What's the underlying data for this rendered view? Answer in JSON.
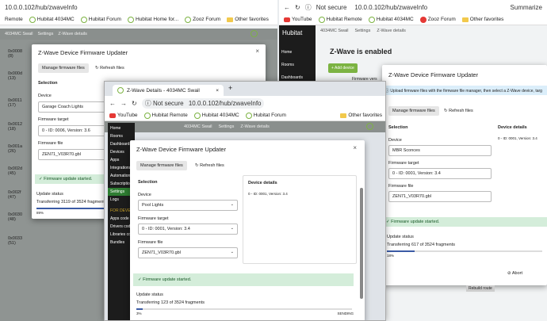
{
  "colors": {
    "accent": "#3b5ba5",
    "success_bg": "#d4edda",
    "hubitat_green": "#7cb342",
    "sidebar": "#1c1c1c"
  },
  "win_left": {
    "url": "10.0.0.102/hub/zwaveInfo",
    "bookmarks": [
      "Remote",
      "Hubitat 4034MC",
      "Hubitat Forum",
      "Hubitat Home for...",
      "Zooz Forum",
      "Other favorites"
    ],
    "breadcrumb": [
      "4034MC Swail",
      "Settings",
      "Z-Wave details"
    ],
    "rows": [
      "0x0008\n(8)",
      "0x000d\n(13)",
      "0x0011\n(17)",
      "0x0012\n(18)",
      "0x001a\n(26)",
      "0x002d\n(45)",
      "0x002f\n(47)",
      "0x0030\n(48)",
      "0x0033\n(51)"
    ],
    "modal": {
      "title": "Z-Wave Device Firmware Updater",
      "manage": "Manage firmware files",
      "refresh": "Refresh files",
      "selection": "Selection",
      "device_label": "Device",
      "device": "Garage Coach Lights",
      "target_label": "Firmware target",
      "target": "0 - ID: 0006, Version: 3.6",
      "file_label": "Firmware file",
      "file": "ZEN71_V03R70.gbl",
      "alert": "Firmware update started.",
      "status_label": "Update status",
      "status": "Transferring 3119 of 3524 fragments",
      "progress": 89,
      "pct": "89%"
    }
  },
  "win_mid": {
    "tab": "Z-Wave Details - 4034MC Swail",
    "url": "10.0.0.102/hub/zwaveInfo",
    "not_secure": "Not secure",
    "bookmarks": [
      "YouTube",
      "Hubitat Remote",
      "Hubitat 4034MC",
      "Hubitat Forum",
      "Other favorites"
    ],
    "breadcrumb": [
      "4034MC Swail",
      "Settings",
      "Z-Wave details"
    ],
    "sidebar": [
      "Home",
      "Rooms",
      "Dashboards",
      "Devices",
      "Apps",
      "Integrations",
      "Automations",
      "Subscriptions",
      "Settings",
      "Logs",
      "FOR DEVELOPERS",
      "Apps code",
      "Drivers code",
      "Libraries code",
      "Bundles"
    ],
    "modal": {
      "title": "Z-Wave Device Firmware Updater",
      "manage": "Manage firmware files",
      "refresh": "Refresh files",
      "selection": "Selection",
      "details": "Device details",
      "details_text": "0 - ID: 0001, Version: 3.4",
      "device_label": "Device",
      "device": "Pool Lights",
      "target_label": "Firmware target",
      "target": "0 - ID: 0001, Version: 3.4",
      "file_label": "Firmware file",
      "file": "ZEN71_V03R70.gbl",
      "alert": "Firmware update started.",
      "status_label": "Update status",
      "status": "Transferring 123 of 3524 fragments",
      "progress": 3,
      "pct": "3%",
      "state": "SENDING"
    }
  },
  "win_right": {
    "url": "10.0.0.102/hub/zwaveInfo",
    "not_secure": "Not secure",
    "summarize": "Summarize",
    "bookmarks": [
      "YouTube",
      "Hubitat Remote",
      "Hubitat 4034MC",
      "Zooz Forum",
      "Other favorites"
    ],
    "app": "Hubitat",
    "breadcrumb": [
      "4034MC Swail",
      "Settings",
      "Z-Wave details"
    ],
    "sidebar": [
      "Home",
      "Rooms",
      "Dashboards"
    ],
    "zwave": "Z-Wave is enabled",
    "add_device": "+ Add device",
    "fw_ver": "Firmware vers",
    "modal": {
      "title": "Z-Wave Device Firmware Updater",
      "info": "Upload firmware files with the firmware file manager, then select a Z-Wave device, targ",
      "manage": "Manage firmware files",
      "refresh": "Refresh files",
      "selection": "Selection",
      "details": "Device details",
      "details_text": "0 - ID: 0001, Version: 3.4",
      "device_label": "Device",
      "device": "MBR Sconces",
      "target_label": "Firmware target",
      "target": "0 - ID: 0001, Version: 3.4",
      "file_label": "Firmware file",
      "file": "ZEN71_V03R70.gbl",
      "alert": "Firmware update started.",
      "status_label": "Update status",
      "status": "Transferring 617 of 3524 fragments",
      "progress": 18,
      "pct": "18%",
      "abort": "Abort",
      "rebuild": "Rebuild route"
    }
  }
}
